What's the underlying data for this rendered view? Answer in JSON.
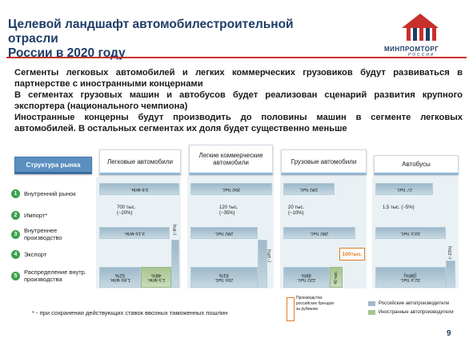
{
  "header": {
    "title_line1": "Целевой ландшафт автомобилестроительной отрасли",
    "title_line2": "России в 2020 году",
    "logo_name": "МИНПРОМТОРГ",
    "logo_sub": "РОССИИ"
  },
  "intro": [
    "Сегменты легковых автомобилей и легких коммерческих грузовиков будут развиваться в партнерстве с иностранными концернами",
    "В сегментах грузовых машин и автобусов будет реализован сценарий развития крупного экспортера (национального чемпиона)",
    "Иностранные концерны будут производить до половины машин в сегменте легковых автомобилей. В остальных сегментах их доля будет существенно меньше"
  ],
  "table": {
    "row_header": "Структура рынка",
    "columns": [
      {
        "label": "Легковые автомобили"
      },
      {
        "label": "Легкие коммерческие автомобили"
      },
      {
        "label": "Грузовые автомобили"
      },
      {
        "label": "Автобусы"
      }
    ],
    "rows": [
      {
        "num": "1",
        "label": "Внутренний рынок"
      },
      {
        "num": "2",
        "label": "Импорт*"
      },
      {
        "num": "3",
        "label": "Внутреннее производство"
      },
      {
        "num": "4",
        "label": "Экспорт"
      },
      {
        "num": "5",
        "label": "Распределение внутр. производства"
      }
    ],
    "cells": {
      "cars": {
        "market": "3,6 млн.",
        "import": "700 тыс. (~20%)",
        "production": "3,15 млн.",
        "export": "(~8%)",
        "dist_a": "1,65 млн.",
        "dist_a_pct": "52%",
        "dist_b": "1,5 млн.",
        "dist_b_pct": "48%"
      },
      "lcv": {
        "market": "350 тыс.",
        "import": "120 тыс. (~35%)",
        "production": "280 тыс.",
        "export": "(~18%)",
        "dist_a": "255 тыс.",
        "dist_a_pct": "91%"
      },
      "trucks": {
        "market": "190 тыс.",
        "import": "20 тыс. (~10%)",
        "production": "260 тыс.",
        "export_box": "100тыс.",
        "dist_a": "220 тыс.",
        "dist_a_pct": "86%",
        "dist_b": "40 тыс."
      },
      "buses": {
        "market": "27 тыс.",
        "import": "1,5 тыс. (~5%)",
        "production": "33,5 тыс.",
        "export": "(~23%)",
        "dist_a": "32,5 тыс.",
        "dist_a_pct": "(98%)"
      }
    }
  },
  "legend": {
    "brand_note": "Производство российских брендов за рубежом",
    "russian": "Российские автопроизводители",
    "foreign": "Иностранные автопроизводители"
  },
  "footnote": "* - при сохранении действующих ставок ввозных таможенных пошлин",
  "page_number": "9",
  "colors": {
    "title": "#1f3d66",
    "accent_red": "#c9302c",
    "bar_blue": "#9db8c9",
    "bar_green": "#a7c48f",
    "number_green": "#3aa14b",
    "header_blue": "#5b8fbf",
    "export_orange": "#e07b24"
  }
}
